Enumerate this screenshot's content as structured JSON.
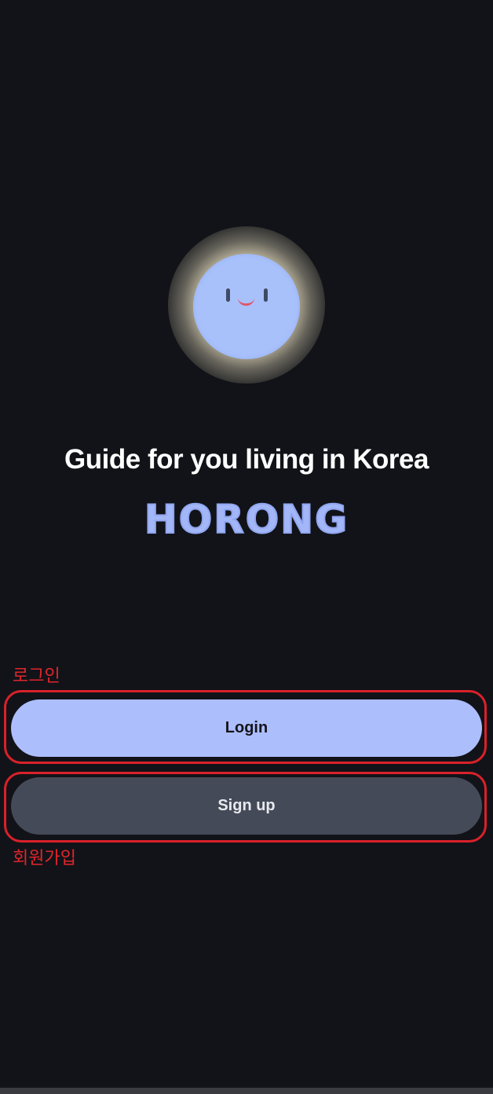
{
  "intro": {
    "tagline": "Guide for you living in Korea",
    "brand": "HORONG",
    "mascot_icon": "smiling-moon-icon"
  },
  "actions": {
    "login_label": "Login",
    "signup_label": "Sign up"
  },
  "annotations": {
    "login_note": "로그인",
    "signup_note": "회원가입"
  },
  "colors": {
    "background": "#121318",
    "primary_button": "#adbefd",
    "secondary_button": "#444a57",
    "brand": "#a3b6f7",
    "annotation": "#e0262d"
  }
}
